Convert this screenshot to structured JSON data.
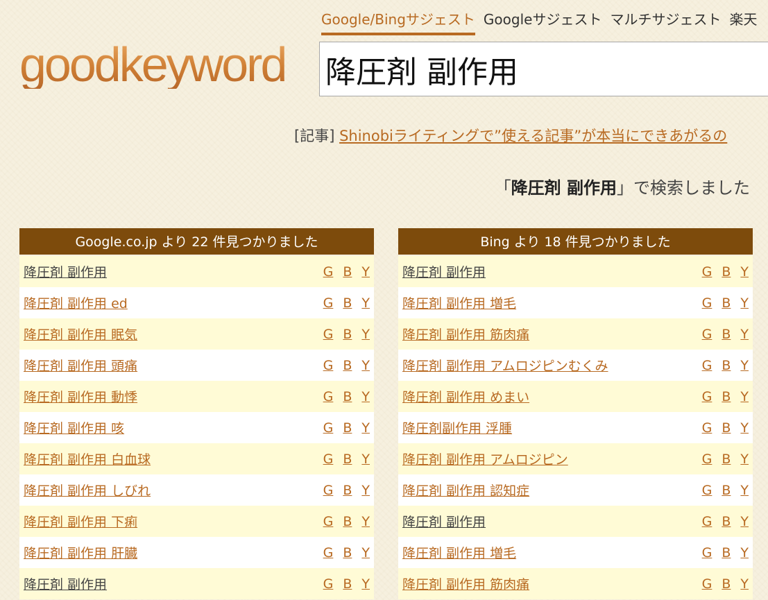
{
  "logo": "goodkeyword",
  "nav": [
    "Google/Bingサジェスト",
    "Googleサジェスト",
    "マルチサジェスト",
    "楽天"
  ],
  "search": {
    "value": "降圧剤 副作用"
  },
  "article": {
    "prefix": "[記事] ",
    "link": "Shinobiライティングで”使える記事”が本当にできあがるの"
  },
  "result": {
    "open": "「",
    "query": "降圧剤 副作用",
    "close": "」で検索しました"
  },
  "ext_labels": [
    "G",
    "B",
    "Y"
  ],
  "google": {
    "header": "Google.co.jp より 22 件見つかりました",
    "items": [
      {
        "text": "降圧剤 副作用",
        "visited": true
      },
      {
        "text": "降圧剤 副作用 ed",
        "visited": false
      },
      {
        "text": "降圧剤 副作用 眠気",
        "visited": false
      },
      {
        "text": "降圧剤 副作用 頭痛",
        "visited": false
      },
      {
        "text": "降圧剤 副作用 動悸",
        "visited": false
      },
      {
        "text": "降圧剤 副作用 咳",
        "visited": false
      },
      {
        "text": "降圧剤 副作用 白血球",
        "visited": false
      },
      {
        "text": "降圧剤 副作用 しびれ",
        "visited": false
      },
      {
        "text": "降圧剤 副作用 下痢",
        "visited": false
      },
      {
        "text": "降圧剤 副作用 肝臓",
        "visited": false
      },
      {
        "text": "降圧剤 副作用",
        "visited": true
      }
    ]
  },
  "bing": {
    "header": "Bing より 18 件見つかりました",
    "items": [
      {
        "text": "降圧剤 副作用",
        "visited": true
      },
      {
        "text": "降圧剤 副作用 増毛",
        "visited": false
      },
      {
        "text": "降圧剤 副作用 筋肉痛",
        "visited": false
      },
      {
        "text": "降圧剤 副作用 アムロジピンむくみ",
        "visited": false
      },
      {
        "text": "降圧剤 副作用 めまい",
        "visited": false
      },
      {
        "text": "降圧剤副作用 浮腫",
        "visited": false
      },
      {
        "text": "降圧剤 副作用 アムロジピン",
        "visited": false
      },
      {
        "text": "降圧剤 副作用 認知症",
        "visited": false
      },
      {
        "text": "降圧剤 副作用",
        "visited": true
      },
      {
        "text": "降圧剤 副作用 増毛",
        "visited": false
      },
      {
        "text": "降圧剤 副作用 筋肉痛",
        "visited": false
      }
    ]
  }
}
